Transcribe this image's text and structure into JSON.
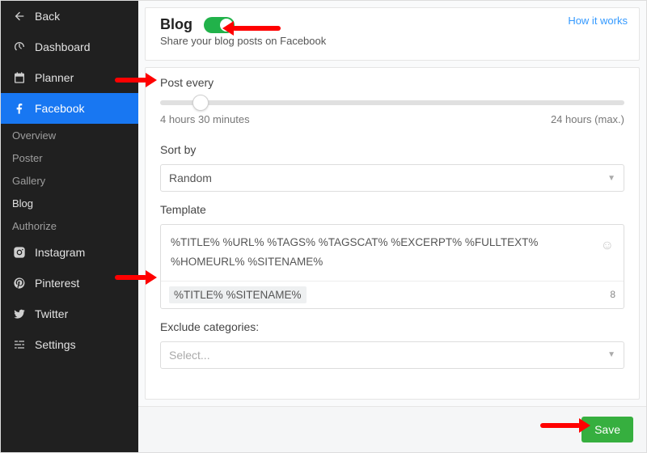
{
  "sidebar": {
    "back": "Back",
    "dashboard": "Dashboard",
    "planner": "Planner",
    "facebook": "Facebook",
    "sub_overview": "Overview",
    "sub_poster": "Poster",
    "sub_gallery": "Gallery",
    "sub_blog": "Blog",
    "sub_authorize": "Authorize",
    "instagram": "Instagram",
    "pinterest": "Pinterest",
    "twitter": "Twitter",
    "settings": "Settings"
  },
  "header": {
    "title": "Blog",
    "subtitle": "Share your blog posts on Facebook",
    "how": "How it works"
  },
  "form": {
    "post_every_label": "Post every",
    "range_min": "4 hours 30 minutes",
    "range_max": "24 hours (max.)",
    "sort_label": "Sort by",
    "sort_value": "Random",
    "template_label": "Template",
    "placeholders": "%TITLE%   %URL%   %TAGS%   %TAGSCAT%   %EXCERPT%   %FULLTEXT%   %HOMEURL%   %SITENAME%",
    "template_value": "%TITLE% %SITENAME%",
    "template_count": "8",
    "exclude_label": "Exclude categories:",
    "exclude_placeholder": "Select...",
    "save": "Save"
  }
}
